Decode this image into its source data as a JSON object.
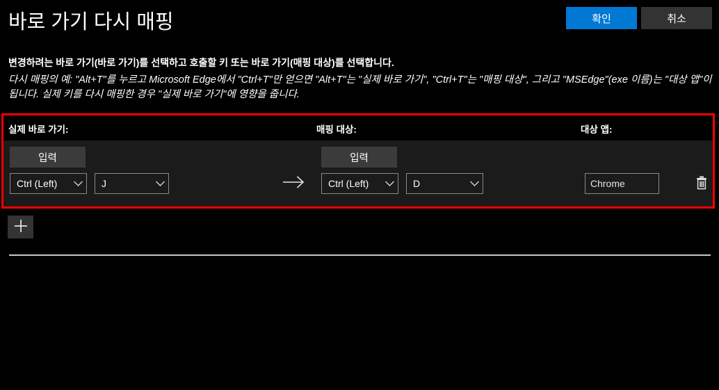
{
  "header": {
    "title": "바로 가기 다시 매핑",
    "ok_label": "확인",
    "cancel_label": "취소",
    "accent_color": "#0078d4",
    "secondary_color": "#333333"
  },
  "description": {
    "instruction": "변경하려는 바로 가기(바로 가기)를 선택하고 호출할 키 또는 바로 가기(매핑 대상)를 선택합니다.",
    "example": "다시 매핑의 예: \"Alt+T\"를 누르고 Microsoft Edge에서 \"Ctrl+T\"만 얻으면 \"Alt+T\"는 \"실제 바로 가기\", \"Ctrl+T\"는 \"매핑 대상\", 그리고 \"MSEdge\"(exe 이름)는 \"대상 앱\"이 됩니다. 실제 키를 다시 매핑한 경우 \"실제 바로 가기\"에 영향을 줍니다."
  },
  "table": {
    "highlight_color": "#ff0000",
    "columns": {
      "original": "실제 바로 가기:",
      "new": "매핑 대상:",
      "target_app": "대상 앱:"
    },
    "row": {
      "original_type_button": "입력",
      "original_modifier": "Ctrl (Left)",
      "original_key": "J",
      "arrow_icon": "arrow-right-icon",
      "new_type_button": "입력",
      "new_modifier": "Ctrl (Left)",
      "new_key": "D",
      "target_app_value": "Chrome",
      "target_app_placeholder": "",
      "delete_icon": "trash-icon"
    }
  },
  "add_row": {
    "icon": "plus-icon",
    "label": "+"
  }
}
